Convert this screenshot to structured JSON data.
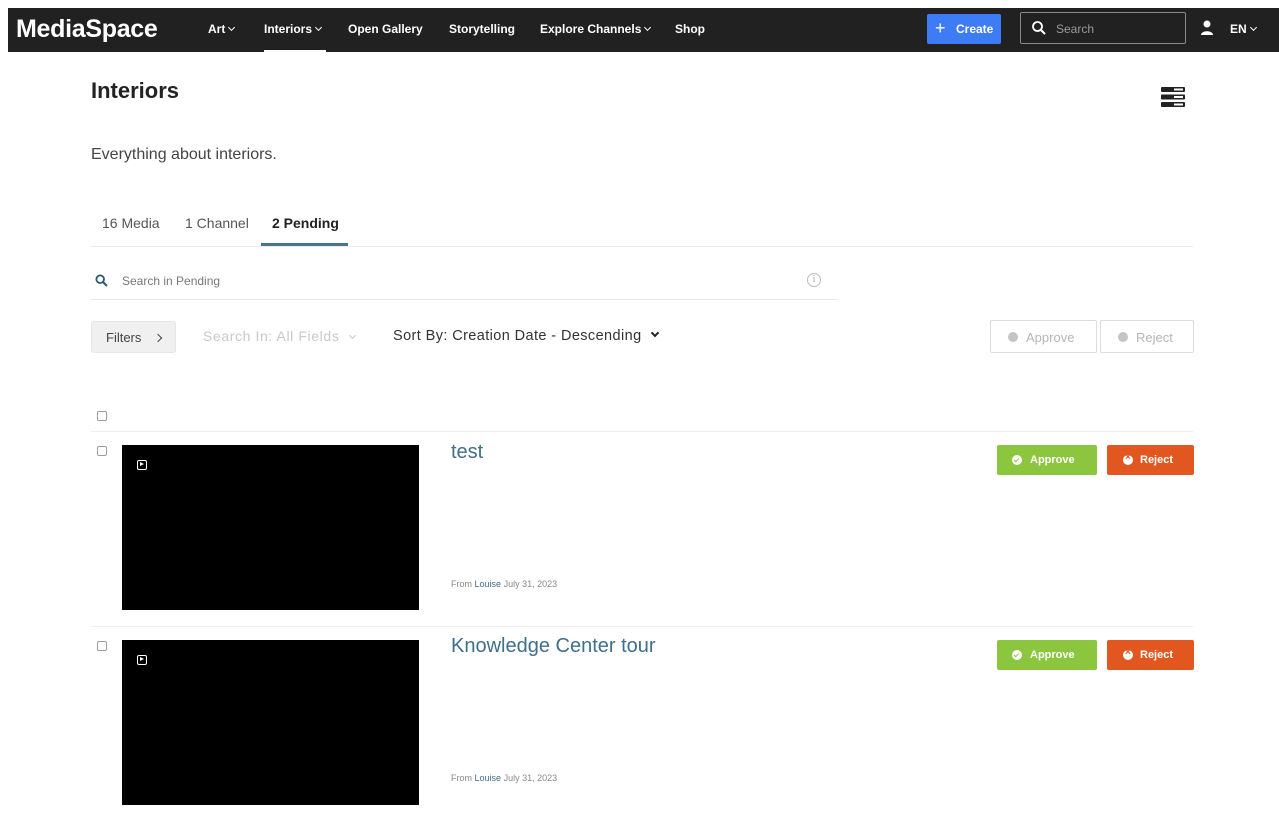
{
  "topnav": {
    "logo": "MediaSpace",
    "items": [
      {
        "label": "Art",
        "has_dropdown": true
      },
      {
        "label": "Interiors",
        "has_dropdown": true,
        "active": true
      },
      {
        "label": "Open Gallery",
        "has_dropdown": false
      },
      {
        "label": "Storytelling",
        "has_dropdown": false
      },
      {
        "label": "Explore Channels",
        "has_dropdown": true
      },
      {
        "label": "Shop",
        "has_dropdown": false
      }
    ],
    "create_label": "Create",
    "search_placeholder": "Search",
    "language": "EN"
  },
  "page": {
    "title": "Interiors",
    "description": "Everything about interiors."
  },
  "tabs": [
    {
      "label": "16 Media"
    },
    {
      "label": "1 Channel"
    },
    {
      "label": "2 Pending",
      "active": true
    }
  ],
  "pending_search": {
    "placeholder": "Search in Pending",
    "info_icon": "i"
  },
  "toolbar": {
    "filters_label": "Filters",
    "search_in_label": "Search In: All Fields",
    "sort_label": "Sort By: Creation Date - Descending",
    "approve_label": "Approve",
    "reject_label": "Reject"
  },
  "entries": [
    {
      "title": "test",
      "from_label": "From",
      "author": "Louise",
      "date": "July 31, 2023",
      "approve_label": "Approve",
      "reject_label": "Reject"
    },
    {
      "title": "Knowledge Center tour",
      "from_label": "From",
      "author": "Louise",
      "date": "July 31, 2023",
      "approve_label": "Approve",
      "reject_label": "Reject"
    }
  ],
  "colors": {
    "topbar": "#212121",
    "create_button": "#3d7cf4",
    "link": "#3f6f8b",
    "approve": "#8cc63f",
    "reject": "#e2561f"
  }
}
